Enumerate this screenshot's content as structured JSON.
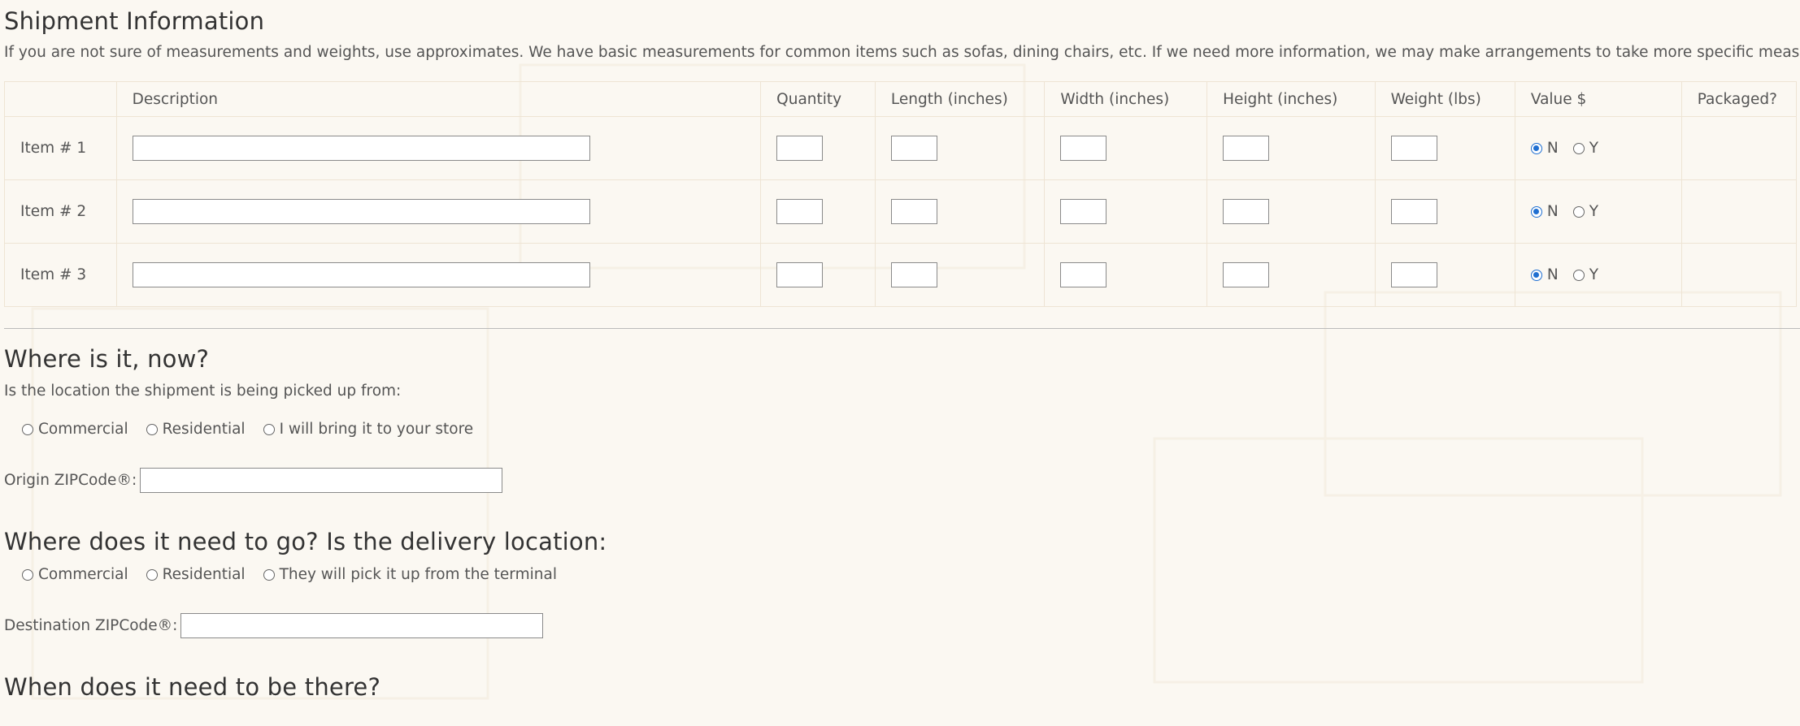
{
  "shipment": {
    "title": "Shipment Information",
    "intro": "If you are not sure of measurements and weights, use approximates. We have basic measurements for common items such as sofas, dining chairs, etc. If we need more information, we may make arrangements to take more specific measurements.",
    "columns": [
      "",
      "Description",
      "Quantity",
      "Length (inches)",
      "Width (inches)",
      "Height (inches)",
      "Weight (lbs)",
      "Value $",
      "Packaged?"
    ],
    "items": [
      {
        "label": "Item # 1",
        "value_choice": "N"
      },
      {
        "label": "Item # 2",
        "value_choice": "N"
      },
      {
        "label": "Item # 3",
        "value_choice": "N"
      }
    ],
    "yn_options": [
      "N",
      "Y"
    ]
  },
  "origin": {
    "title": "Where is it, now?",
    "question": "Is the location the shipment is being picked up from:",
    "options": [
      "Commercial",
      "Residential",
      "I will bring it to your store"
    ],
    "zip_label": "Origin ZIPCode®:",
    "zip_value": ""
  },
  "destination": {
    "title": "Where does it need to go? Is the delivery location:",
    "options": [
      "Commercial",
      "Residential",
      "They will pick it up from the terminal"
    ],
    "zip_label": "Destination ZIPCode®:",
    "zip_value": ""
  },
  "timing": {
    "title": "When does it need to be there?"
  },
  "colors": {
    "background": "#fbf8f2",
    "radio_checked": "#1f6fd1",
    "text": "#333333"
  }
}
